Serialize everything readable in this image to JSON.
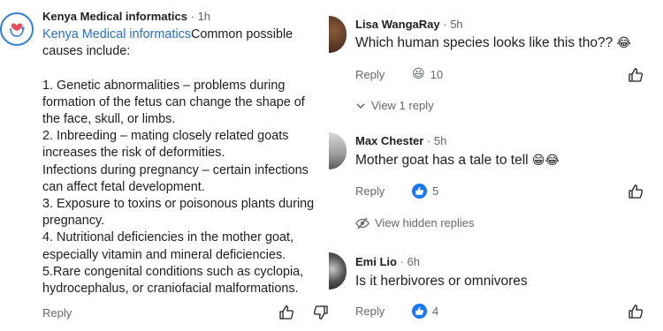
{
  "left_comment": {
    "author": "Kenya Medical informatics",
    "time": "1h",
    "mention": "Kenya Medical informatics",
    "lines": [
      "Common possible",
      "causes include:",
      "",
      "1. Genetic abnormalities – problems during",
      "formation of the fetus can change the shape of",
      "the face, skull, or limbs.",
      "2. Inbreeding – mating closely related goats",
      "increases the risk of deformities.",
      "Infections during pregnancy – certain infections",
      "can affect fetal development.",
      "3. Exposure to toxins or poisonous plants during",
      "pregnancy.",
      "4. Nutritional deficiencies in the mother goat,",
      "especially vitamin and mineral deficiencies.",
      "5.Rare congenital conditions such as cyclopia,",
      "hydrocephalus, or craniofacial malformations."
    ],
    "reply_label": "Reply"
  },
  "right_comments": [
    {
      "author": "Lisa WangaRay",
      "time": "5h",
      "text": "Which human species looks like this tho??",
      "text_emoji": "😂",
      "reply_label": "Reply",
      "reaction_emoji": "😆",
      "reaction_count": "10",
      "thread_link": "View 1 reply"
    },
    {
      "author": "Max Chester",
      "time": "5h",
      "text": "Mother goat has a tale to tell",
      "text_emoji": "😁😂",
      "reply_label": "Reply",
      "reaction_count": "5",
      "thread_link": "View hidden replies"
    },
    {
      "author": "Emi Lio",
      "time": "6h",
      "text": "Is it herbivores or omnivores",
      "reply_label": "Reply",
      "reaction_count": "4"
    }
  ],
  "colors": {
    "mention": "#2a6fc9",
    "like_badge": "#1877f2",
    "meta": "#65676b"
  },
  "icons": [
    "medical-logo-icon",
    "thumbs-up-icon",
    "thumbs-down-icon",
    "chevron-down-icon",
    "hidden-eye-icon"
  ]
}
